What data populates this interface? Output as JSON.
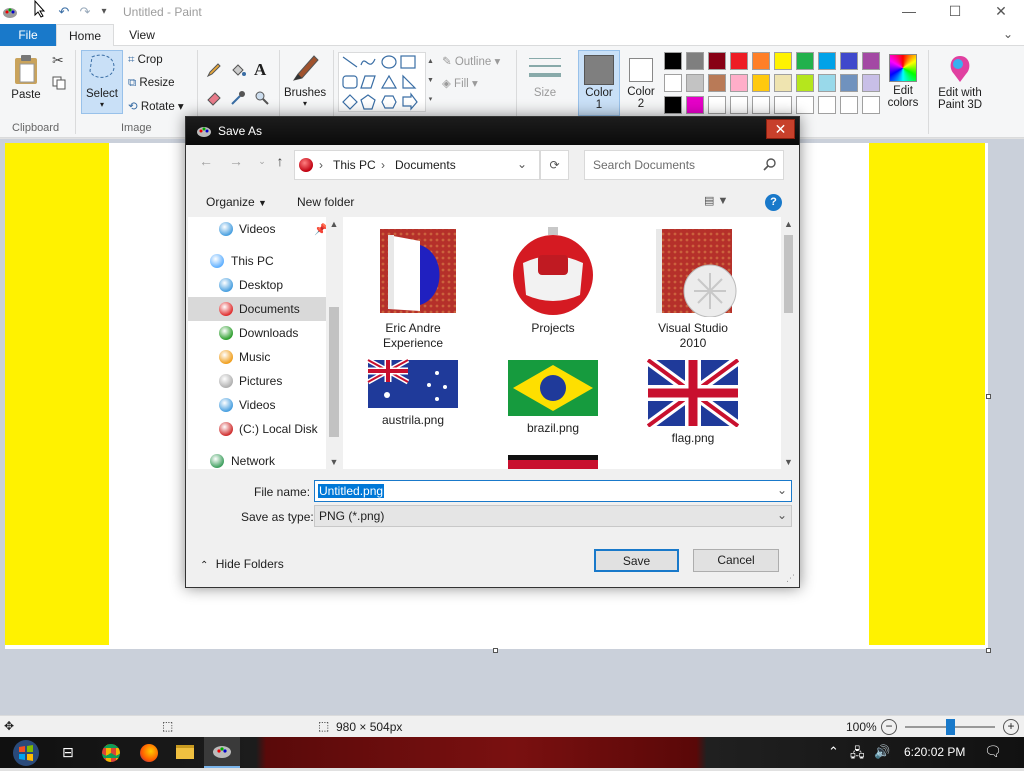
{
  "window": {
    "title": "Untitled - Paint",
    "minimize": "—",
    "maximize": "☐",
    "close": "✕"
  },
  "quick_access": {
    "undo": "↶",
    "redo": "↷",
    "customize": "▾"
  },
  "menu": {
    "file": "File",
    "home": "Home",
    "view": "View"
  },
  "ribbon": {
    "clipboard": {
      "paste": "Paste",
      "cut_icon": "✂",
      "label": "Clipboard"
    },
    "image": {
      "select": "Select",
      "crop": "Crop",
      "resize": "Resize",
      "rotate": "Rotate",
      "label": "Image"
    },
    "tools": {
      "text_tool": "A"
    },
    "brushes": "Brushes",
    "shapes": {
      "outline": "Outline",
      "fill": "Fill"
    },
    "size": "Size",
    "color1": {
      "line1": "Color",
      "line2": "1"
    },
    "color2": {
      "line1": "Color",
      "line2": "2"
    },
    "edit_colors": {
      "line1": "Edit",
      "line2": "colors"
    },
    "edit_3d": {
      "line1": "Edit with",
      "line2": "Paint 3D"
    },
    "palette_row1": [
      "#000000",
      "#7f7f7f",
      "#880015",
      "#ed1c24",
      "#ff7f27",
      "#fff200",
      "#22b14c",
      "#00a2e8",
      "#3f48cc",
      "#a349a4"
    ],
    "palette_row2": [
      "#ffffff",
      "#c3c3c3",
      "#b97a57",
      "#ffaec9",
      "#ffc90e",
      "#efe4b0",
      "#b5e61d",
      "#99d9ea",
      "#7092be",
      "#c8bfe7"
    ],
    "palette_row3": [
      "#000000",
      "#e600c8",
      "#ffffff",
      "#ffffff",
      "#ffffff",
      "#ffffff",
      "#ffffff",
      "#ffffff",
      "#ffffff",
      "#ffffff"
    ]
  },
  "dialog": {
    "title": "Save As",
    "close": "✕",
    "breadcrumb": {
      "root": "This PC",
      "folder": "Documents"
    },
    "search_placeholder": "Search Documents",
    "organize": "Organize",
    "new_folder": "New folder",
    "help": "?",
    "nav_items": [
      "Videos",
      "This PC",
      "Desktop",
      "Documents",
      "Downloads",
      "Music",
      "Pictures",
      "Videos",
      "(C:) Local Disk",
      "Network"
    ],
    "files": [
      {
        "name_line1": "Eric Andre",
        "name_line2": "Experience"
      },
      {
        "name_line1": "Projects",
        "name_line2": ""
      },
      {
        "name_line1": "Visual Studio",
        "name_line2": "2010"
      },
      {
        "name_line1": "austrila.png",
        "name_line2": ""
      },
      {
        "name_line1": "brazil.png",
        "name_line2": ""
      },
      {
        "name_line1": "flag.png",
        "name_line2": ""
      }
    ],
    "file_name_label": "File name:",
    "file_name_value": "Untitled.png",
    "save_type_label": "Save as type:",
    "save_type_value": "PNG (*.png)",
    "hide_folders": "Hide Folders",
    "save": "Save",
    "cancel": "Cancel"
  },
  "status": {
    "dimensions": "980 × 504px",
    "zoom": "100%",
    "zoom_out": "−",
    "zoom_in": "+"
  },
  "taskbar": {
    "time": "6:20:02 PM"
  }
}
